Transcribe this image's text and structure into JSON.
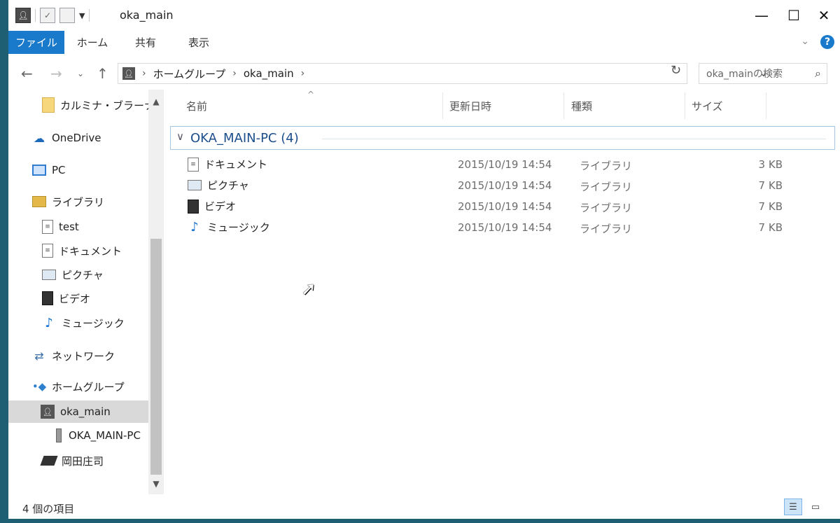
{
  "window": {
    "title": "oka_main",
    "controls": {
      "minimize": "—",
      "maximize": "☐",
      "close": "✕"
    }
  },
  "ribbon": {
    "tabs": [
      "ファイル",
      "ホーム",
      "共有",
      "表示"
    ]
  },
  "address": {
    "breadcrumb": [
      "ホームグループ",
      "oka_main"
    ],
    "search_placeholder": "oka_mainの検索"
  },
  "nav_pane": {
    "items": [
      {
        "label": "カルミナ・ブラーナ",
        "icon": "folder-icon"
      },
      {
        "label": "OneDrive",
        "icon": "cloud-icon"
      },
      {
        "label": "PC",
        "icon": "pc-icon"
      },
      {
        "label": "ライブラリ",
        "icon": "library-icon"
      },
      {
        "label": "test",
        "icon": "document-icon"
      },
      {
        "label": "ドキュメント",
        "icon": "document-icon"
      },
      {
        "label": "ピクチャ",
        "icon": "picture-icon"
      },
      {
        "label": "ビデオ",
        "icon": "video-icon"
      },
      {
        "label": "ミュージック",
        "icon": "music-icon"
      },
      {
        "label": "ネットワーク",
        "icon": "network-icon"
      },
      {
        "label": "ホームグループ",
        "icon": "homegroup-icon"
      },
      {
        "label": "oka_main",
        "icon": "user-icon",
        "selected": true
      },
      {
        "label": "OKA_MAIN-PC",
        "icon": "computer-icon"
      },
      {
        "label": "岡田庄司",
        "icon": "drive-icon"
      }
    ]
  },
  "columns": [
    "名前",
    "更新日時",
    "種類",
    "サイズ"
  ],
  "group": {
    "title": "OKA_MAIN-PC (4)"
  },
  "files": [
    {
      "name": "ドキュメント",
      "date": "2015/10/19 14:54",
      "type": "ライブラリ",
      "size": "3 KB",
      "icon": "document-icon"
    },
    {
      "name": "ピクチャ",
      "date": "2015/10/19 14:54",
      "type": "ライブラリ",
      "size": "7 KB",
      "icon": "picture-icon"
    },
    {
      "name": "ビデオ",
      "date": "2015/10/19 14:54",
      "type": "ライブラリ",
      "size": "7 KB",
      "icon": "video-icon"
    },
    {
      "name": "ミュージック",
      "date": "2015/10/19 14:54",
      "type": "ライブラリ",
      "size": "7 KB",
      "icon": "music-icon"
    }
  ],
  "status": {
    "item_count": "4 個の項目"
  }
}
